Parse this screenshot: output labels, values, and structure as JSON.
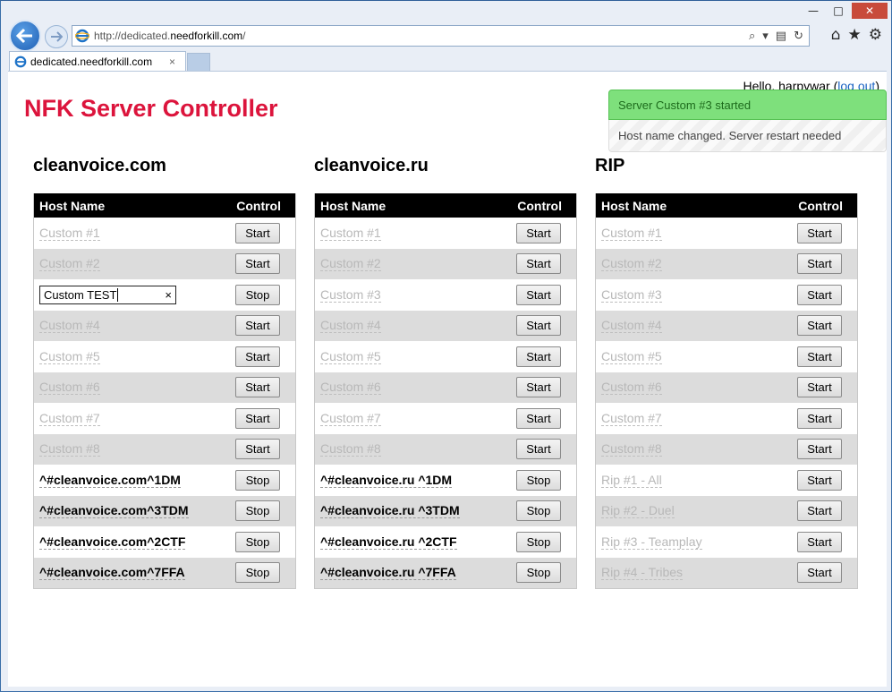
{
  "browser": {
    "url_prefix": "http://dedicated.",
    "url_domain": "needforkill.com",
    "url_suffix": "/",
    "tab_title": "dedicated.needforkill.com",
    "tab_close": "×",
    "minimize": "—",
    "maximize": "□",
    "close": "✕"
  },
  "header": {
    "hello": "Hello, harpywar (",
    "logout": "log out",
    "hello_end": ")",
    "title": "NFK Server Controller"
  },
  "notices": {
    "success": "Server Custom #3 started",
    "info": "Host name changed. Server restart needed"
  },
  "table_headers": {
    "host": "Host Name",
    "control": "Control"
  },
  "servers": [
    {
      "title": "cleanvoice.com",
      "rows": [
        {
          "name": "Custom #1",
          "action": "Start",
          "active": false
        },
        {
          "name": "Custom #2",
          "action": "Start",
          "active": false
        },
        {
          "name": "Custom TEST",
          "action": "Stop",
          "active": true,
          "editing": true
        },
        {
          "name": "Custom #4",
          "action": "Start",
          "active": false
        },
        {
          "name": "Custom #5",
          "action": "Start",
          "active": false
        },
        {
          "name": "Custom #6",
          "action": "Start",
          "active": false
        },
        {
          "name": "Custom #7",
          "action": "Start",
          "active": false
        },
        {
          "name": "Custom #8",
          "action": "Start",
          "active": false
        },
        {
          "name": "^#cleanvoice.com^1DM",
          "action": "Stop",
          "active": true
        },
        {
          "name": "^#cleanvoice.com^3TDM",
          "action": "Stop",
          "active": true
        },
        {
          "name": "^#cleanvoice.com^2CTF",
          "action": "Stop",
          "active": true
        },
        {
          "name": "^#cleanvoice.com^7FFA",
          "action": "Stop",
          "active": true
        }
      ]
    },
    {
      "title": "cleanvoice.ru",
      "rows": [
        {
          "name": "Custom #1",
          "action": "Start",
          "active": false
        },
        {
          "name": "Custom #2",
          "action": "Start",
          "active": false
        },
        {
          "name": "Custom #3",
          "action": "Start",
          "active": false
        },
        {
          "name": "Custom #4",
          "action": "Start",
          "active": false
        },
        {
          "name": "Custom #5",
          "action": "Start",
          "active": false
        },
        {
          "name": "Custom #6",
          "action": "Start",
          "active": false
        },
        {
          "name": "Custom #7",
          "action": "Start",
          "active": false
        },
        {
          "name": "Custom #8",
          "action": "Start",
          "active": false
        },
        {
          "name": "^#cleanvoice.ru ^1DM",
          "action": "Stop",
          "active": true
        },
        {
          "name": "^#cleanvoice.ru ^3TDM",
          "action": "Stop",
          "active": true
        },
        {
          "name": "^#cleanvoice.ru ^2CTF",
          "action": "Stop",
          "active": true
        },
        {
          "name": "^#cleanvoice.ru ^7FFA",
          "action": "Stop",
          "active": true
        }
      ]
    },
    {
      "title": "RIP",
      "rows": [
        {
          "name": "Custom #1",
          "action": "Start",
          "active": false
        },
        {
          "name": "Custom #2",
          "action": "Start",
          "active": false
        },
        {
          "name": "Custom #3",
          "action": "Start",
          "active": false
        },
        {
          "name": "Custom #4",
          "action": "Start",
          "active": false
        },
        {
          "name": "Custom #5",
          "action": "Start",
          "active": false
        },
        {
          "name": "Custom #6",
          "action": "Start",
          "active": false
        },
        {
          "name": "Custom #7",
          "action": "Start",
          "active": false
        },
        {
          "name": "Custom #8",
          "action": "Start",
          "active": false
        },
        {
          "name": "Rip #1 - All",
          "action": "Start",
          "active": false
        },
        {
          "name": "Rip #2 - Duel",
          "action": "Start",
          "active": false
        },
        {
          "name": "Rip #3 - Teamplay",
          "action": "Start",
          "active": false
        },
        {
          "name": "Rip #4 - Tribes",
          "action": "Start",
          "active": false
        }
      ]
    }
  ]
}
